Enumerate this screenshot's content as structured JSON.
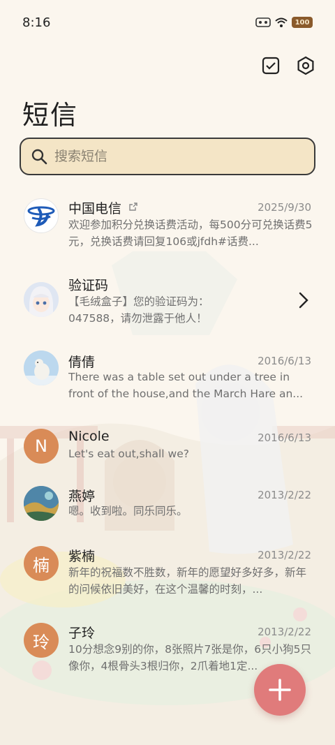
{
  "status_bar": {
    "time": "8:16",
    "battery": "100"
  },
  "header": {
    "title": "短信"
  },
  "search": {
    "placeholder": "搜索短信"
  },
  "messages": [
    {
      "name": "中国电信",
      "date": "2025/9/30",
      "preview": "欢迎参加积分兑换话费活动，每500分可兑换话费5元，兑换话费请回复106或jfdh#话费...",
      "avatar": "telecom-logo"
    },
    {
      "name": "验证码",
      "date": "",
      "preview": "【毛绒盒子】您的验证码为：047588，请勿泄露于他人！",
      "avatar": "anime-character"
    },
    {
      "name": "倩倩",
      "date": "2016/6/13",
      "preview": "There was a table set out under a tree in front of the house,and the March Hare an...",
      "avatar": "polar-bear-photo"
    },
    {
      "name": "Nicole",
      "date": "2016/6/13",
      "preview": "Let's eat out,shall we?",
      "avatar_letter": "N"
    },
    {
      "name": "燕婷",
      "date": "2013/2/22",
      "preview": "嗯。收到啦。同乐同乐。",
      "avatar": "landscape-photo"
    },
    {
      "name": "紫楠",
      "date": "2013/2/22",
      "preview": "新年的祝福数不胜数，新年的愿望好多好多，新年的问候依旧美好，在这个温馨的时刻，...",
      "avatar_letter": "楠"
    },
    {
      "name": "子玲",
      "date": "2013/2/22",
      "preview": "10分想念9别的你，8张照片7张是你，6只小狗5只像你，4根骨头3根归你，2爪着地1定...",
      "avatar_letter": "玲"
    }
  ],
  "colors": {
    "accent": "#e07b7b",
    "letter_avatar": "#d98b57",
    "search_bg": "#f4e5c6"
  },
  "icons": {
    "top_left_action": "checkbox-icon",
    "top_right_action": "settings-hexagon-icon",
    "fab": "plus-icon"
  }
}
